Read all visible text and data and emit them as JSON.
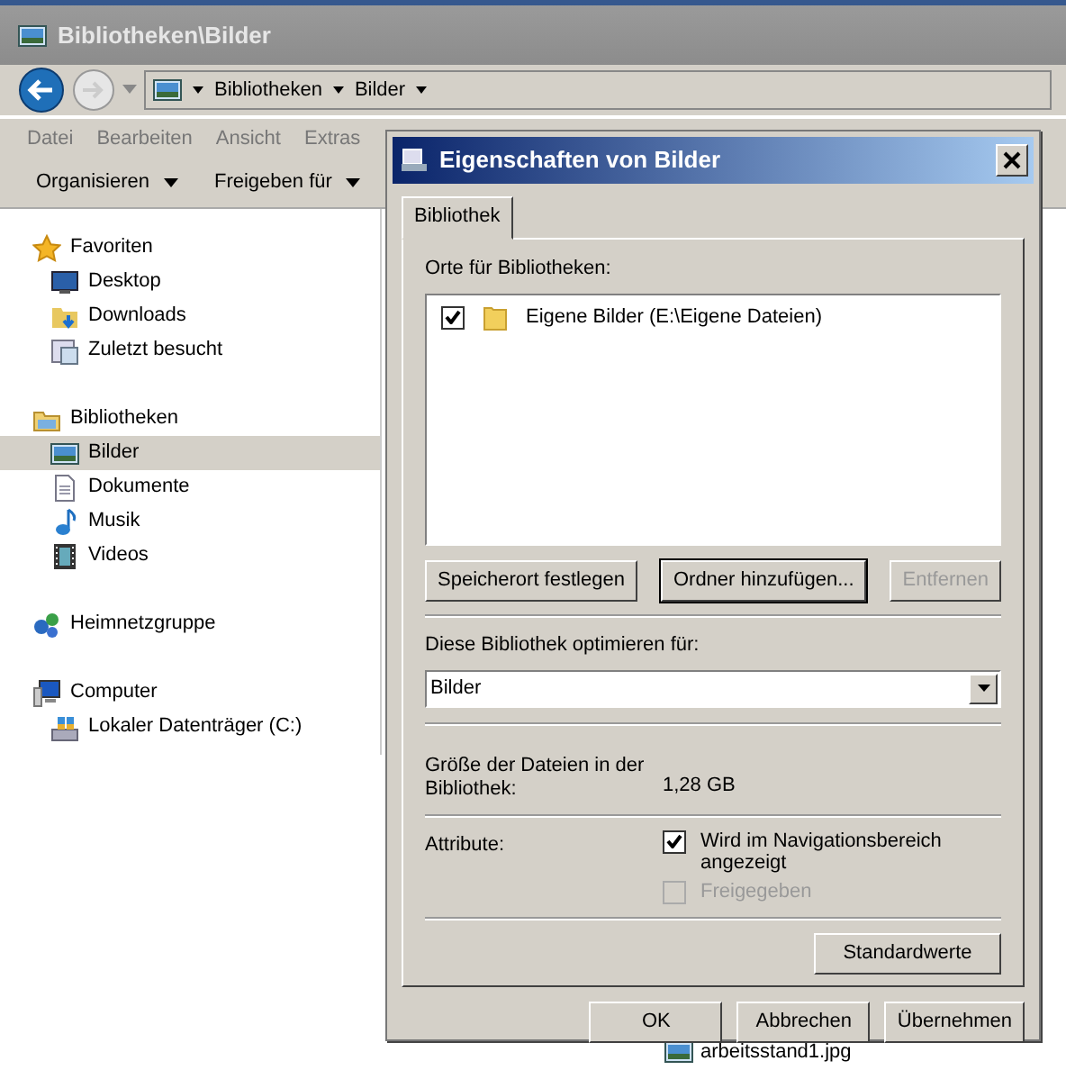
{
  "explorer": {
    "title": "Bibliotheken\\Bilder",
    "breadcrumb": [
      "Bibliotheken",
      "Bilder"
    ],
    "menu": [
      "Datei",
      "Bearbeiten",
      "Ansicht",
      "Extras"
    ],
    "toolbar": [
      "Organisieren",
      "Freigeben für"
    ],
    "nav": [
      {
        "label": "Favoriten",
        "selected": false,
        "children": [
          {
            "label": "Desktop",
            "selected": false
          },
          {
            "label": "Downloads",
            "selected": false
          },
          {
            "label": "Zuletzt besucht",
            "selected": false
          }
        ]
      },
      {
        "label": "Bibliotheken",
        "selected": false,
        "children": [
          {
            "label": "Bilder",
            "selected": true
          },
          {
            "label": "Dokumente",
            "selected": false
          },
          {
            "label": "Musik",
            "selected": false
          },
          {
            "label": "Videos",
            "selected": false
          }
        ]
      },
      {
        "label": "Heimnetzgruppe",
        "selected": false
      },
      {
        "label": "Computer",
        "selected": false,
        "children": [
          {
            "label": "Lokaler Datenträger (C:)",
            "selected": false
          }
        ]
      }
    ],
    "files": [
      "arbeitsstand1.jpg"
    ]
  },
  "dialog": {
    "title": "Eigenschaften von Bilder",
    "tabs": [
      {
        "label": "Bibliothek",
        "selected": true
      }
    ],
    "locations_label": "Orte für Bibliotheken:",
    "locations": [
      {
        "label": "Eigene Bilder (E:\\Eigene Dateien)",
        "checked": true
      }
    ],
    "location_buttons": [
      {
        "label": "Speicherort festlegen",
        "disabled": false,
        "focused": false
      },
      {
        "label": "Ordner hinzufügen...",
        "disabled": false,
        "focused": true
      },
      {
        "label": "Entfernen",
        "disabled": true,
        "focused": false
      }
    ],
    "optimize_label": "Diese Bibliothek optimieren für:",
    "optimize_value": "Bilder",
    "size_label": "Größe der Dateien in der Bibliothek:",
    "size_value": "1,28 GB",
    "attributes_label": "Attribute:",
    "attributes": [
      {
        "label": "Wird im Navigationsbereich angezeigt",
        "checked": true,
        "disabled": false
      },
      {
        "label": "Freigegeben",
        "checked": false,
        "disabled": true
      }
    ],
    "defaults_button": "Standardwerte",
    "footer_buttons": [
      {
        "label": "OK"
      },
      {
        "label": "Abbrechen"
      },
      {
        "label": "Übernehmen"
      }
    ]
  }
}
